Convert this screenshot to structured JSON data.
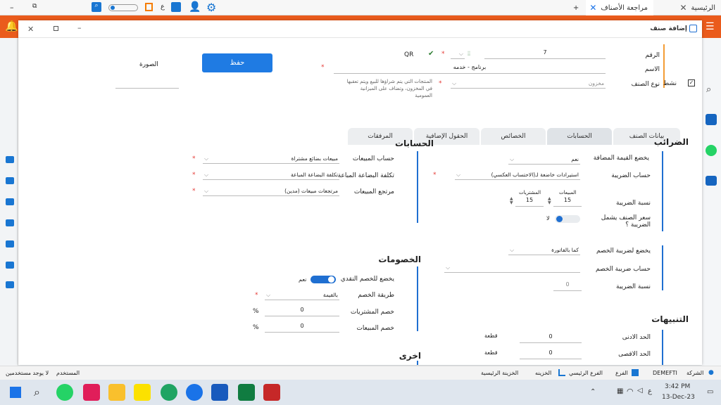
{
  "browser_tabs": {
    "home": "الرئيسية",
    "review": "مراجعة الأصناف",
    "new_tab": "+"
  },
  "app_badge": "ع",
  "modal": {
    "title": "إضافة صنف",
    "fields": {
      "number_label": "الرقم",
      "number_value": "7",
      "qr_label": "QR",
      "name_label": "الاسم",
      "name_value": "برنامج - خدمه",
      "type_label": "نوع الصنف",
      "type_value": "مخزون",
      "type_hint": "المنتجات التي يتم شراؤها للبيع ويتم تعقبها في المخزون، وتضاف على الميزانية العمومية",
      "active_label": "نشط",
      "active_checked": true,
      "save_label": "حفظ",
      "image_label": "الصورة"
    },
    "tabs": [
      "بيانات الصنف",
      "الحسابات",
      "الخصائص",
      "الحقول الإضافية",
      "المرفقات"
    ],
    "active_tab": 1,
    "taxes": {
      "title": "الضرائب",
      "vat_label": "يخضع القيمة المضافة",
      "vat_value": "نعم",
      "tax_account_label": "حساب الضريبة",
      "tax_account_value": "استيرادات خاضعة لـ(الاحتساب العكسي)",
      "rate_label": "نسبة الضريبة",
      "sales_label": "المبيعات",
      "sales_value": "15",
      "purchases_label": "المشتريات",
      "purchases_value": "15",
      "incl_label": "سعر الصنف يشمل الضريبة ؟",
      "incl_value": "لا",
      "discount_tax_label": "يخضع لضريبة الخصم",
      "discount_tax_value": "كما بالفاتورة",
      "discount_tax_account_label": "حساب ضريبة الخصم",
      "discount_rate_label": "نسبة الضريبة",
      "discount_rate_value": "0"
    },
    "accounts": {
      "title": "الحسابات",
      "sales_account_label": "حساب المبيعات",
      "sales_account_value": "مبيعات بضائع مشتراة",
      "cogs_label": "تكلفة البضاعة المباعة",
      "cogs_value": "تكلفة البضاعة المباعة",
      "returns_label": "مرتجع المبيعات",
      "returns_value": "مرتجعات مبيعات (مدين)"
    },
    "discounts": {
      "title": "الخصومات",
      "cash_label": "يخضع للخصم النقدي",
      "cash_value": "نعم",
      "method_label": "طريقة الخصم",
      "method_value": "بالقيمة",
      "purchase_disc_label": "خصم المشتريات",
      "purchase_disc_value": "0",
      "percent": "%",
      "sales_disc_label": "خصم المبيعات",
      "sales_disc_value": "0"
    },
    "alerts": {
      "title": "التنبيهات",
      "min_label": "الحد الادنى",
      "min_value": "0",
      "unit": "قطعة",
      "max_label": "الحد الاقصى",
      "max_value": "0"
    },
    "other_title": "اخرى"
  },
  "status_bar": {
    "company_label": "الشركة",
    "company_value": "DEMEFTI",
    "branch_label": "الفرع",
    "main_branch": "الفرع الرئيسي",
    "treasury": "الخزينه",
    "main_treasury": "الخزينة الرئيسية",
    "user_label": "المستخدم",
    "no_user": "لا يوجد مستخدمين"
  },
  "taskbar": {
    "time": "3:42 PM",
    "date": "13-Dec-23",
    "lang": "ع"
  }
}
